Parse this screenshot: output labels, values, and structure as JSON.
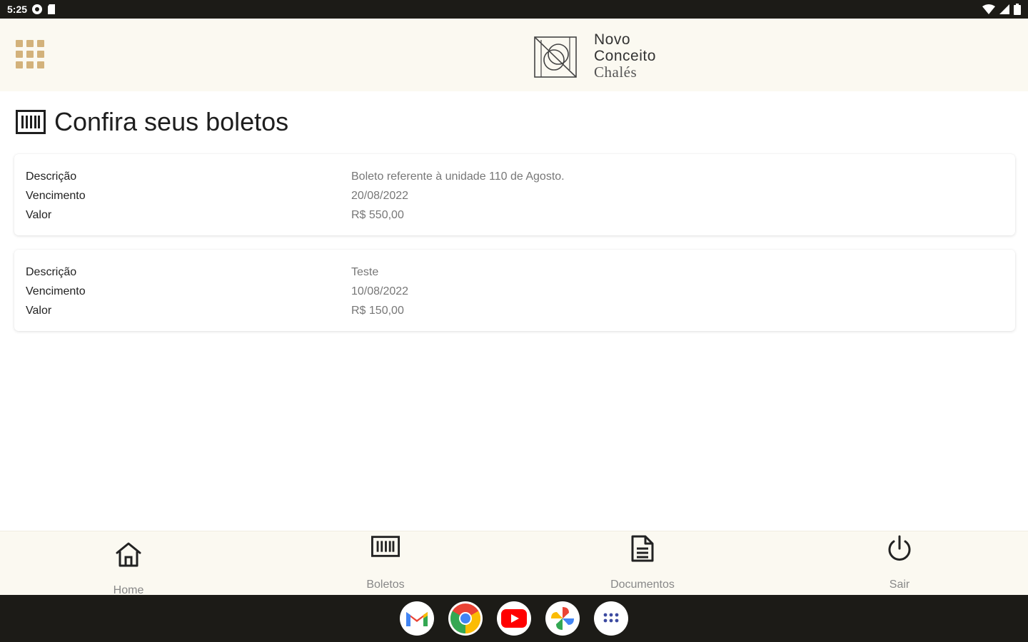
{
  "status_bar": {
    "time": "5:25"
  },
  "brand": {
    "line1": "Novo",
    "line2": "Conceito",
    "line3": "Chalés",
    "accent_color": "#d3b27b"
  },
  "page": {
    "title": "Confira seus boletos"
  },
  "boletos": [
    {
      "desc_label": "Descrição",
      "desc_value": "Boleto referente à unidade 110 de Agosto.",
      "venc_label": "Vencimento",
      "venc_value": "20/08/2022",
      "valor_label": "Valor",
      "valor_value": "R$ 550,00"
    },
    {
      "desc_label": "Descrição",
      "desc_value": "Teste",
      "venc_label": "Vencimento",
      "venc_value": "10/08/2022",
      "valor_label": "Valor",
      "valor_value": "R$ 150,00"
    }
  ],
  "bottom_nav": {
    "home": "Home",
    "boletos": "Boletos",
    "documentos": "Documentos",
    "sair": "Sair"
  },
  "dock": {
    "apps": [
      "gmail-icon",
      "chrome-icon",
      "youtube-icon",
      "photos-icon",
      "app-drawer-icon"
    ]
  }
}
